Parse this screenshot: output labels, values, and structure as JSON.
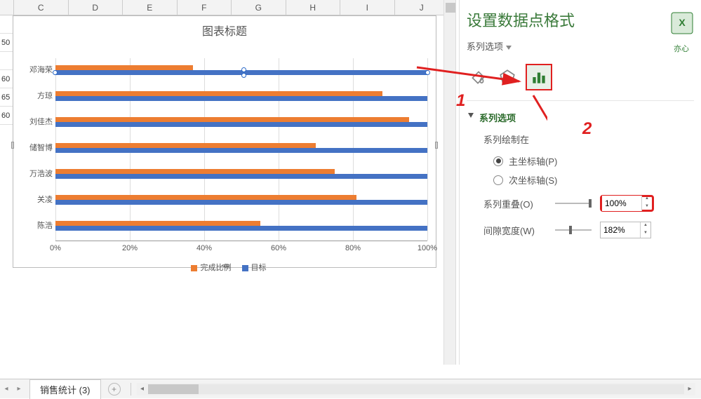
{
  "columns": [
    "C",
    "D",
    "E",
    "F",
    "G",
    "H",
    "I",
    "J"
  ],
  "row_cells_left": [
    "",
    "50",
    "",
    "60",
    "65",
    "60"
  ],
  "chart_data": {
    "type": "bar",
    "title": "图表标题",
    "categories": [
      "邓海荣",
      "方琼",
      "刘佳杰",
      "储智博",
      "万浩波",
      "关凌",
      "陈浩"
    ],
    "series": [
      {
        "name": "完成比例",
        "values": [
          37,
          88,
          95,
          70,
          75,
          81,
          55
        ],
        "color": "#ED7D31"
      },
      {
        "name": "目标",
        "values": [
          100,
          100,
          100,
          100,
          100,
          100,
          100
        ],
        "color": "#4472C4"
      }
    ],
    "xlabel": "",
    "ylabel": "",
    "xlim": [
      0,
      100
    ],
    "x_ticks": [
      "0%",
      "20%",
      "40%",
      "60%",
      "80%",
      "100%"
    ],
    "legend": [
      "完成比例",
      "目标"
    ],
    "selected_series_index": 1,
    "selected_point_index": 0
  },
  "panel": {
    "title": "设置数据点格式",
    "series_dropdown": "系列选项",
    "tabs": {
      "fill": "fill-icon",
      "effects": "effects-icon",
      "series": "series-options-icon"
    },
    "section_title": "系列选项",
    "plot_on_label": "系列绘制在",
    "primary_axis": "主坐标轴(P)",
    "secondary_axis": "次坐标轴(S)",
    "overlap_label": "系列重叠(O)",
    "overlap_value": "100%",
    "gap_label": "间隙宽度(W)",
    "gap_value": "182%"
  },
  "annotations": {
    "one": "1",
    "two": "2"
  },
  "sheet_tab": "销售统计 (3)",
  "logo_sub": "亦心"
}
